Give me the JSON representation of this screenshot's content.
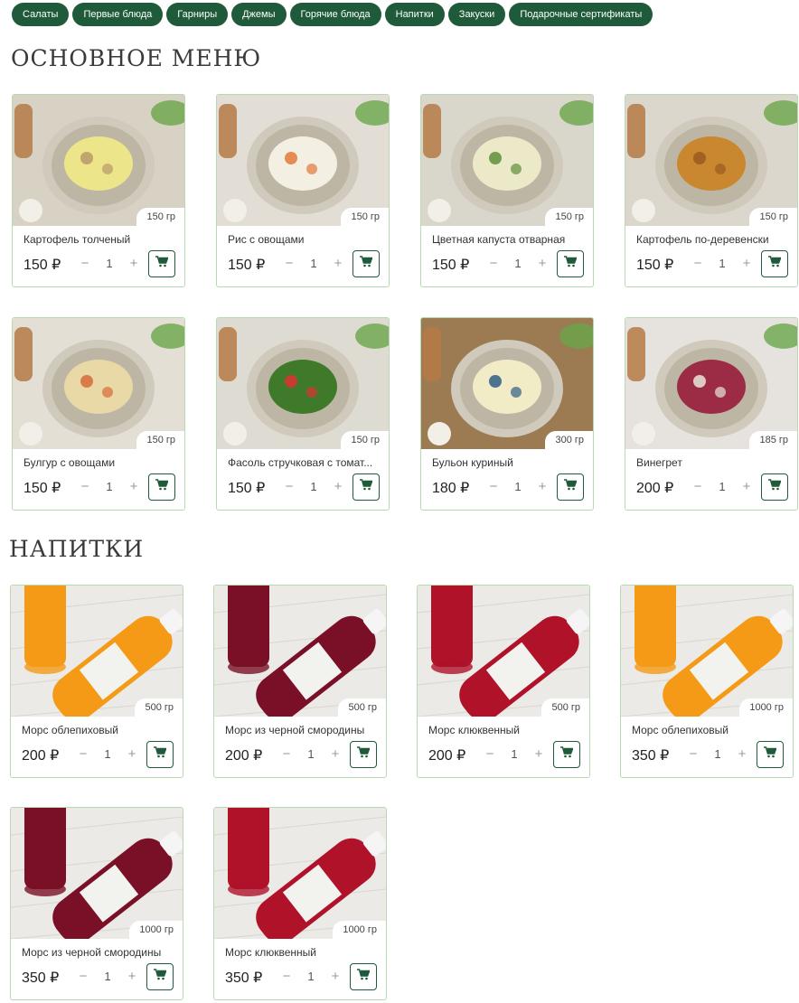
{
  "categories": [
    "Салаты",
    "Первые блюда",
    "Гарниры",
    "Джемы",
    "Горячие блюда",
    "Напитки",
    "Закуски",
    "Подарочные сертификаты"
  ],
  "sections": [
    {
      "title": "ОСНОВНОЕ МЕНЮ",
      "items": [
        {
          "name": "Картофель толченый",
          "weight": "150 гр",
          "price": "150 ₽",
          "qty": "1",
          "photo": "mashed-potatoes"
        },
        {
          "name": "Рис с овощами",
          "weight": "150 гр",
          "price": "150 ₽",
          "qty": "1",
          "photo": "rice-vegetables"
        },
        {
          "name": "Цветная капуста отварная",
          "weight": "150 гр",
          "price": "150 ₽",
          "qty": "1",
          "photo": "cauliflower"
        },
        {
          "name": "Картофель по-деревенски",
          "weight": "150 гр",
          "price": "150 ₽",
          "qty": "1",
          "photo": "potato-wedges"
        },
        {
          "name": "Булгур с овощами",
          "weight": "150 гр",
          "price": "150 ₽",
          "qty": "1",
          "photo": "bulgur"
        },
        {
          "name": "Фасоль стручковая с томат...",
          "weight": "150 гр",
          "price": "150 ₽",
          "qty": "1",
          "photo": "green-beans"
        },
        {
          "name": "Бульон куриный",
          "weight": "300 гр",
          "price": "180 ₽",
          "qty": "1",
          "photo": "chicken-broth"
        },
        {
          "name": "Винегрет",
          "weight": "185 гр",
          "price": "200 ₽",
          "qty": "1",
          "photo": "vinaigrette"
        }
      ]
    },
    {
      "title": "НАПИТКИ",
      "items": [
        {
          "name": "Морс облепиховый",
          "weight": "500 гр",
          "price": "200 ₽",
          "qty": "1",
          "photo": "sea-buckthorn-drink"
        },
        {
          "name": "Морс из черной смородины",
          "weight": "500 гр",
          "price": "200 ₽",
          "qty": "1",
          "photo": "blackcurrant-drink"
        },
        {
          "name": "Морс клюквенный",
          "weight": "500 гр",
          "price": "200 ₽",
          "qty": "1",
          "photo": "cranberry-drink"
        },
        {
          "name": "Морс облепиховый",
          "weight": "1000 гр",
          "price": "350 ₽",
          "qty": "1",
          "photo": "sea-buckthorn-drink"
        },
        {
          "name": "Морс из черной смородины",
          "weight": "1000 гр",
          "price": "350 ₽",
          "qty": "1",
          "photo": "blackcurrant-drink"
        },
        {
          "name": "Морс клюквенный",
          "weight": "1000 гр",
          "price": "350 ₽",
          "qty": "1",
          "photo": "cranberry-drink"
        }
      ]
    }
  ],
  "qty_controls": {
    "minus": "−",
    "plus": "+"
  },
  "colors": {
    "accent": "#1f5a3a",
    "card_border": "#b8d9b0"
  }
}
